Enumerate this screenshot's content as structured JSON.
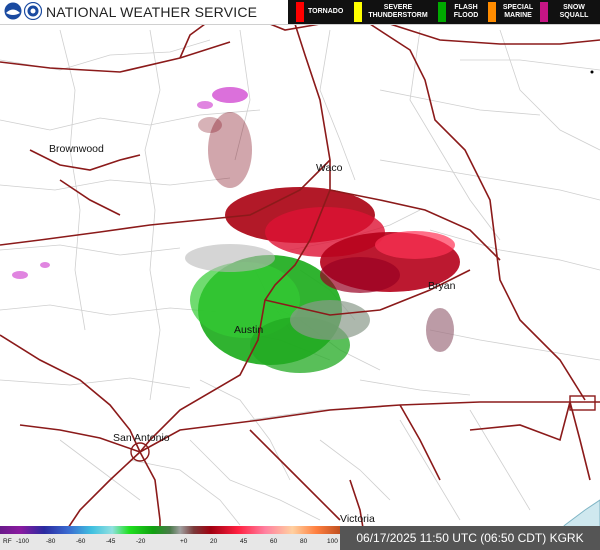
{
  "header": {
    "agency_title": "NATIONAL WEATHER SERVICE",
    "warnings": [
      {
        "label": "TORNADO",
        "color": "#ff0000"
      },
      {
        "label": "SEVERE THUNDERSTORM",
        "color": "#ffff00"
      },
      {
        "label": "FLASH FLOOD",
        "color": "#00aa00"
      },
      {
        "label": "SPECIAL MARINE",
        "color": "#ff8c00"
      },
      {
        "label": "SNOW SQUALL",
        "color": "#c71585"
      }
    ]
  },
  "cities": [
    "Brownwood",
    "Waco",
    "Bryan",
    "Austin",
    "San Antonio",
    "Victoria"
  ],
  "scale": {
    "prefix": "RF",
    "ticks": [
      "-100",
      "-80",
      "-60",
      "-45",
      "-20",
      "+0",
      "20",
      "45",
      "60",
      "80",
      "100"
    ]
  },
  "timestamp": "06/17/2025 11:50 UTC (06:50 CDT) KGRK",
  "colors": {
    "inbound": "#22bb22",
    "outbound": "#cc0022",
    "range_folded": "#cc33cc",
    "highway": "#8b1a1a",
    "county_line": "#cccccc"
  }
}
